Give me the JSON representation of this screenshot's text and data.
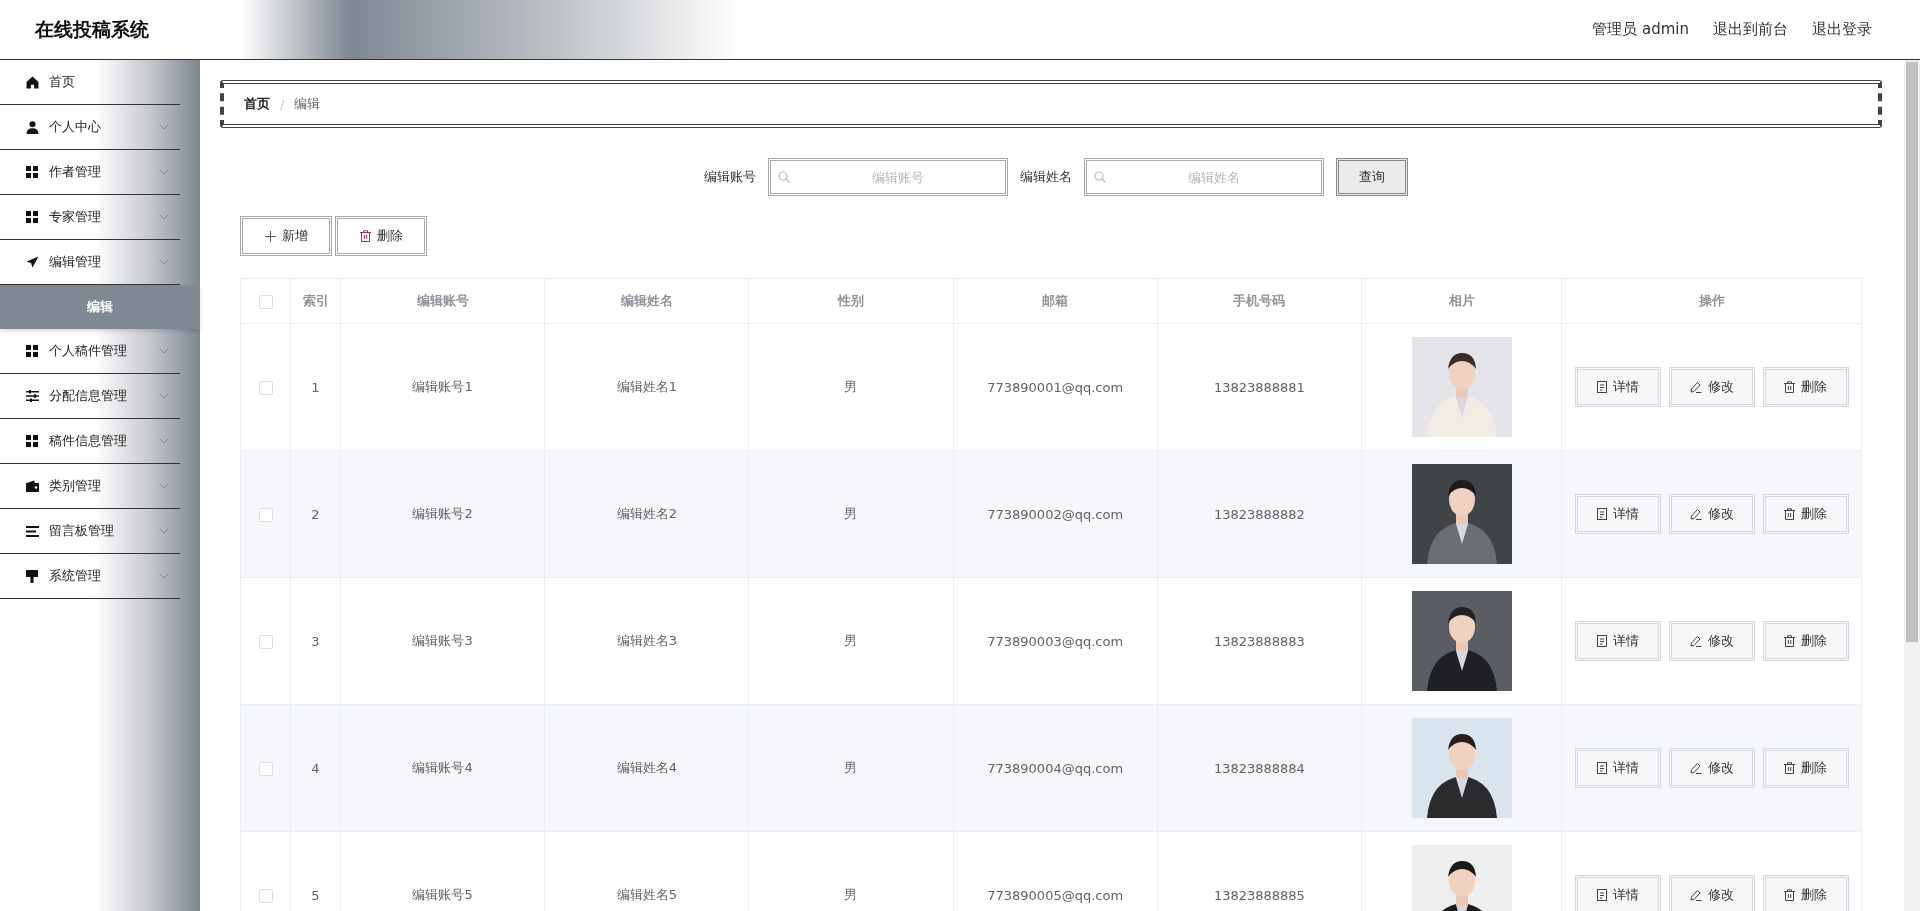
{
  "header": {
    "title": "在线投稿系统",
    "links": [
      "管理员 admin",
      "退出到前台",
      "退出登录"
    ]
  },
  "sidebar": {
    "items": [
      {
        "label": "首页",
        "kind": "link"
      },
      {
        "label": "个人中心",
        "kind": "menu"
      },
      {
        "label": "作者管理",
        "kind": "menu"
      },
      {
        "label": "专家管理",
        "kind": "menu"
      },
      {
        "label": "编辑管理",
        "kind": "menu",
        "children": [
          {
            "label": "编辑",
            "selected": true
          }
        ]
      },
      {
        "label": "个人稿件管理",
        "kind": "menu"
      },
      {
        "label": "分配信息管理",
        "kind": "menu"
      },
      {
        "label": "稿件信息管理",
        "kind": "menu"
      },
      {
        "label": "类别管理",
        "kind": "menu"
      },
      {
        "label": "留言板管理",
        "kind": "menu"
      },
      {
        "label": "系统管理",
        "kind": "menu"
      }
    ]
  },
  "breadcrumb": {
    "items": [
      "首页",
      "编辑"
    ],
    "separator": "/"
  },
  "search": {
    "fields": [
      {
        "label": "编辑账号",
        "placeholder": "编辑账号"
      },
      {
        "label": "编辑姓名",
        "placeholder": "编辑姓名"
      }
    ],
    "button": "查询"
  },
  "actions": [
    "新增",
    "删除"
  ],
  "table": {
    "select_all_checked": false,
    "columns": [
      "索引",
      "编辑账号",
      "编辑姓名",
      "性别",
      "邮箱",
      "手机号码",
      "相片",
      "操作"
    ],
    "rows": [
      {
        "checked": false,
        "cells": [
          "1",
          "编辑账号1",
          "编辑姓名1",
          "男",
          "773890001@qq.com",
          "13823888881"
        ],
        "actions": [
          "详情",
          "修改",
          "删除"
        ]
      },
      {
        "checked": false,
        "cells": [
          "2",
          "编辑账号2",
          "编辑姓名2",
          "男",
          "773890002@qq.com",
          "13823888882"
        ],
        "actions": [
          "详情",
          "修改",
          "删除"
        ]
      },
      {
        "checked": false,
        "cells": [
          "3",
          "编辑账号3",
          "编辑姓名3",
          "男",
          "773890003@qq.com",
          "13823888883"
        ],
        "actions": [
          "详情",
          "修改",
          "删除"
        ]
      },
      {
        "checked": false,
        "cells": [
          "4",
          "编辑账号4",
          "编辑姓名4",
          "男",
          "773890004@qq.com",
          "13823888884"
        ],
        "actions": [
          "详情",
          "修改",
          "删除"
        ]
      },
      {
        "checked": false,
        "cells": [
          "5",
          "编辑账号5",
          "编辑姓名5",
          "男",
          "773890005@qq.com",
          "13823888885"
        ],
        "actions": [
          "详情",
          "修改",
          "删除"
        ]
      }
    ]
  }
}
